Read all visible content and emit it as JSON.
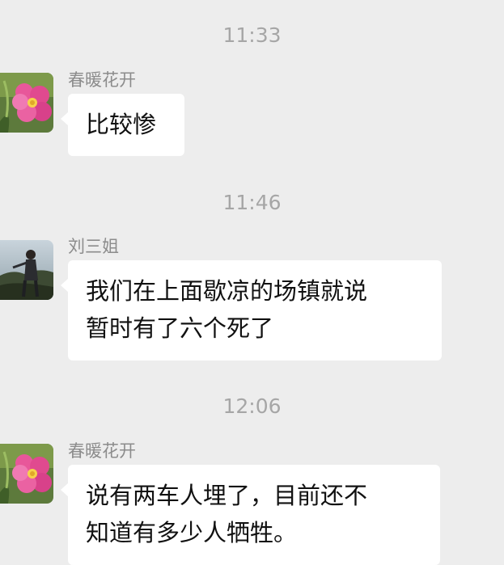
{
  "messages": [
    {
      "time": "11:33",
      "sender": "春暖花开",
      "avatar_icon": "pink-flower-avatar-icon",
      "lines": [
        "比较惨"
      ]
    },
    {
      "time": "11:46",
      "sender": "刘三姐",
      "avatar_icon": "person-photo-avatar-icon",
      "lines": [
        "我们在上面歇凉的场镇就说",
        "暂时有了六个死了"
      ]
    },
    {
      "time": "12:06",
      "sender": "春暖花开",
      "avatar_icon": "pink-flower-avatar-icon",
      "lines": [
        "说有两车人埋了，目前还不",
        "知道有多少人牺牲。"
      ]
    }
  ],
  "colors": {
    "background": "#ededed",
    "bubble": "#ffffff",
    "timestamp_text": "#a6a6a6",
    "sender_text": "#8c8c8c"
  }
}
